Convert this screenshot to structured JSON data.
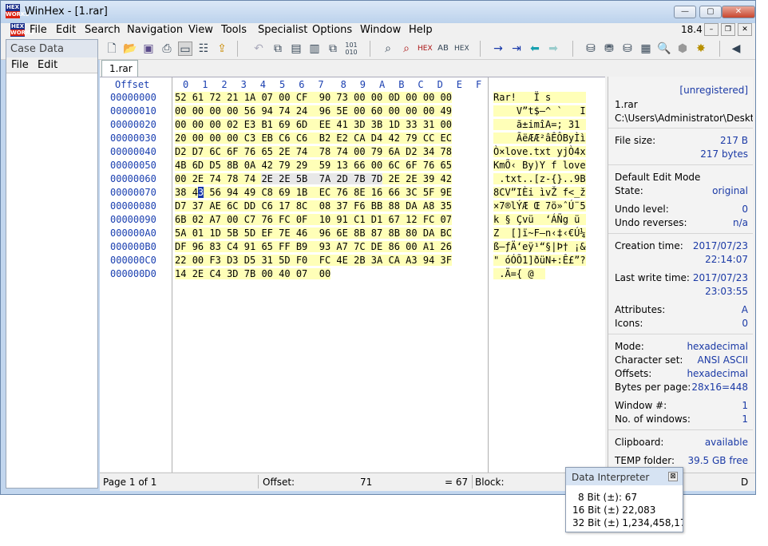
{
  "window": {
    "title": "WinHex - [1.rar]",
    "app_icon_text_top": "HEX",
    "app_icon_text_bottom": "WORKS"
  },
  "caption_buttons": {
    "minimize": "—",
    "maximize": "▢",
    "close": "✕"
  },
  "menu": [
    "File",
    "Edit",
    "Search",
    "Navigation",
    "View",
    "Tools",
    "Specialist",
    "Options",
    "Window",
    "Help"
  ],
  "version": "18.4",
  "mdi_buttons": {
    "minimize": "–",
    "restore": "❐",
    "close": "✕"
  },
  "toolbar_icons": [
    "new-file-icon",
    "open-file-icon",
    "save-icon",
    "print-icon",
    "scanner-icon",
    "properties-icon",
    "open-folder-icon",
    "undo-icon",
    "copy-icon",
    "paste-icon",
    "clipboard-icon",
    "paste-block-icon",
    "binary-icon",
    "find-icon",
    "find-text-icon",
    "find-hex-icon",
    "replace-text-icon",
    "replace-hex-icon",
    "goto-offset-icon",
    "goto-page-icon",
    "back-icon",
    "forward-icon",
    "disk-icon",
    "disks-icon",
    "raid-icon",
    "calculator-icon",
    "search-magnifier-icon",
    "stop-icon",
    "settings-icon",
    "cursor-icon"
  ],
  "case_data": {
    "title": "Case Data",
    "menu": [
      "File",
      "Edit"
    ]
  },
  "tab": {
    "label": "1.rar"
  },
  "hex": {
    "offset_header": "Offset",
    "column_headers": [
      "0",
      "1",
      "2",
      "3",
      "4",
      "5",
      "6",
      "7",
      "8",
      "9",
      "A",
      "B",
      "C",
      "D",
      "E",
      "F"
    ],
    "rows": [
      {
        "offset": "00000000",
        "bytes": [
          "52",
          "61",
          "72",
          "21",
          "1A",
          "07",
          "00",
          "CF",
          "90",
          "73",
          "00",
          "00",
          "0D",
          "00",
          "00",
          "00"
        ],
        "text": "Rar!   Ï s      "
      },
      {
        "offset": "00000010",
        "bytes": [
          "00",
          "00",
          "00",
          "00",
          "56",
          "94",
          "74",
          "24",
          "96",
          "5E",
          "00",
          "60",
          "00",
          "00",
          "00",
          "49"
        ],
        "text": "    V”t$–^ `   I"
      },
      {
        "offset": "00000020",
        "bytes": [
          "00",
          "00",
          "00",
          "02",
          "E3",
          "B1",
          "69",
          "6D",
          "EE",
          "41",
          "3D",
          "3B",
          "1D",
          "33",
          "31",
          "00"
        ],
        "text": "    ã±imîA=; 31 "
      },
      {
        "offset": "00000030",
        "bytes": [
          "20",
          "00",
          "00",
          "00",
          "C3",
          "EB",
          "C6",
          "C6",
          "B2",
          "E2",
          "CA",
          "D4",
          "42",
          "79",
          "CC",
          "EC"
        ],
        "text": "    ÃëÆÆ²âÊÔByÌì"
      },
      {
        "offset": "00000040",
        "bytes": [
          "D2",
          "D7",
          "6C",
          "6F",
          "76",
          "65",
          "2E",
          "74",
          "78",
          "74",
          "00",
          "79",
          "6A",
          "D2",
          "34",
          "78"
        ],
        "text": "Ò×love.txt yjÒ4x"
      },
      {
        "offset": "00000050",
        "bytes": [
          "4B",
          "6D",
          "D5",
          "8B",
          "0A",
          "42",
          "79",
          "29",
          "59",
          "13",
          "66",
          "00",
          "6C",
          "6F",
          "76",
          "65"
        ],
        "text": "KmÕ‹ By)Y f love"
      },
      {
        "offset": "00000060",
        "bytes": [
          "00",
          "2E",
          "74",
          "78",
          "74",
          "2E",
          "2E",
          "5B",
          "7A",
          "2D",
          "7B",
          "7D",
          "2E",
          "2E",
          "39",
          "42"
        ],
        "text": " .txt..[z-{}..9B"
      },
      {
        "offset": "00000070",
        "bytes": [
          "38",
          "43",
          "56",
          "94",
          "49",
          "C8",
          "69",
          "1B",
          "EC",
          "76",
          "8E",
          "16",
          "66",
          "3C",
          "5F",
          "9E"
        ],
        "text": "8CV”IÈi ìvŽ f<_ž"
      },
      {
        "offset": "00000080",
        "bytes": [
          "D7",
          "37",
          "AE",
          "6C",
          "DD",
          "C6",
          "17",
          "8C",
          "08",
          "37",
          "F6",
          "BB",
          "88",
          "DA",
          "A8",
          "35"
        ],
        "text": "×7®lÝÆ Œ 7ö»ˆÚ¨5"
      },
      {
        "offset": "00000090",
        "bytes": [
          "6B",
          "02",
          "A7",
          "00",
          "C7",
          "76",
          "FC",
          "0F",
          "10",
          "91",
          "C1",
          "D1",
          "67",
          "12",
          "FC",
          "07"
        ],
        "text": "k § Çvü  ‘ÁÑg ü "
      },
      {
        "offset": "000000A0",
        "bytes": [
          "5A",
          "01",
          "1D",
          "5B",
          "5D",
          "EF",
          "7E",
          "46",
          "96",
          "6E",
          "8B",
          "87",
          "8B",
          "80",
          "DA",
          "BC"
        ],
        "text": "Z  []ï~F–n‹‡‹€Ú¼"
      },
      {
        "offset": "000000B0",
        "bytes": [
          "DF",
          "96",
          "83",
          "C4",
          "91",
          "65",
          "FF",
          "B9",
          "93",
          "A7",
          "7C",
          "DE",
          "86",
          "00",
          "A1",
          "26"
        ],
        "text": "ß–ƒÄ‘eÿ¹“§|Þ† ¡&"
      },
      {
        "offset": "000000C0",
        "bytes": [
          "22",
          "00",
          "F3",
          "D3",
          "D5",
          "31",
          "5D",
          "F0",
          "FC",
          "4E",
          "2B",
          "3A",
          "CA",
          "A3",
          "94",
          "3F"
        ],
        "text": "\" óÓÕ1]ðüN+:Ê£”?"
      },
      {
        "offset": "000000D0",
        "bytes": [
          "14",
          "2E",
          "C4",
          "3D",
          "7B",
          "00",
          "40",
          "07",
          "00"
        ],
        "text": " .Ä={ @  "
      }
    ]
  },
  "info": {
    "unregistered": "[unregistered]",
    "filename": "1.rar",
    "path": "C:\\Users\\Administrator\\Deskt",
    "file_size_label": "File size:",
    "file_size_kb": "217 B",
    "file_size_bytes": "217 bytes",
    "edit_mode_label": "Default Edit Mode",
    "state_label": "State:",
    "state_value": "original",
    "undo_level_label": "Undo level:",
    "undo_level_value": "0",
    "undo_reverses_label": "Undo reverses:",
    "undo_reverses_value": "n/a",
    "creation_label": "Creation time:",
    "creation_date": "2017/07/23",
    "creation_time": "22:14:07",
    "last_write_label": "Last write time:",
    "last_write_date": "2017/07/23",
    "last_write_time": "23:03:55",
    "attributes_label": "Attributes:",
    "attributes_value": "A",
    "icons_label": "Icons:",
    "icons_value": "0",
    "mode_label": "Mode:",
    "mode_value": "hexadecimal",
    "charset_label": "Character set:",
    "charset_value": "ANSI ASCII",
    "offsets_label": "Offsets:",
    "offsets_value": "hexadecimal",
    "bpp_label": "Bytes per page:",
    "bpp_value": "28x16=448",
    "window_num_label": "Window #:",
    "window_num_value": "1",
    "num_windows_label": "No. of windows:",
    "num_windows_value": "1",
    "clipboard_label": "Clipboard:",
    "clipboard_value": "available",
    "temp_label": "TEMP folder:",
    "temp_value": "39.5 GB free"
  },
  "status": {
    "page": "Page 1 of 1",
    "offset_label": "Offset:",
    "offset_value": "71",
    "equals_value": "= 67",
    "block_label": "Block:",
    "tail": "D"
  },
  "interpreter": {
    "title": "Data Interpreter",
    "bit8": "8 Bit (±): 67",
    "bit16": "16 Bit (±) 22,083",
    "bit32": "32 Bit (±) 1,234,458,17"
  }
}
